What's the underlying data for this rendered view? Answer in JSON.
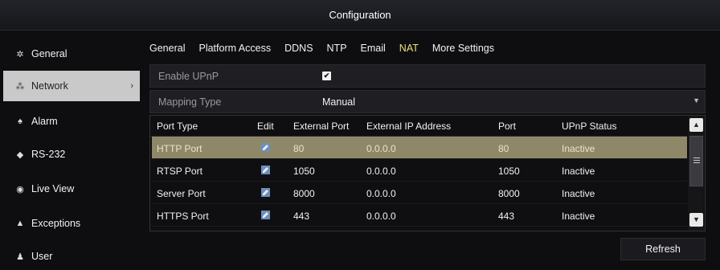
{
  "window": {
    "title": "Configuration"
  },
  "sidebar": {
    "items": [
      {
        "label": "General",
        "icon": "gear-icon"
      },
      {
        "label": "Network",
        "icon": "network-icon",
        "active": true
      },
      {
        "label": "Alarm",
        "icon": "alarm-icon"
      },
      {
        "label": "RS-232",
        "icon": "rs232-icon"
      },
      {
        "label": "Live View",
        "icon": "eye-icon"
      },
      {
        "label": "Exceptions",
        "icon": "warning-icon"
      },
      {
        "label": "User",
        "icon": "user-icon"
      }
    ]
  },
  "tabs": [
    {
      "label": "General"
    },
    {
      "label": "Platform Access"
    },
    {
      "label": "DDNS"
    },
    {
      "label": "NTP"
    },
    {
      "label": "Email"
    },
    {
      "label": "NAT",
      "active": true
    },
    {
      "label": "More Settings"
    }
  ],
  "form": {
    "upnp_label": "Enable UPnP",
    "upnp_checked": true,
    "mapping_label": "Mapping Type",
    "mapping_value": "Manual"
  },
  "table": {
    "headers": [
      "Port Type",
      "Edit",
      "External Port",
      "External IP Address",
      "Port",
      "UPnP Status"
    ],
    "rows": [
      {
        "port_type": "HTTP Port",
        "external_port": "80",
        "external_ip": "0.0.0.0",
        "port": "80",
        "status": "Inactive",
        "selected": true
      },
      {
        "port_type": "RTSP Port",
        "external_port": "1050",
        "external_ip": "0.0.0.0",
        "port": "1050",
        "status": "Inactive"
      },
      {
        "port_type": "Server Port",
        "external_port": "8000",
        "external_ip": "0.0.0.0",
        "port": "8000",
        "status": "Inactive"
      },
      {
        "port_type": "HTTPS Port",
        "external_port": "443",
        "external_ip": "0.0.0.0",
        "port": "443",
        "status": "Inactive"
      }
    ]
  },
  "buttons": {
    "refresh": "Refresh"
  },
  "colors": {
    "selected_row": "#8f8868",
    "active_tab": "#e8e27a",
    "active_sidebar": "#c9c9c9"
  }
}
